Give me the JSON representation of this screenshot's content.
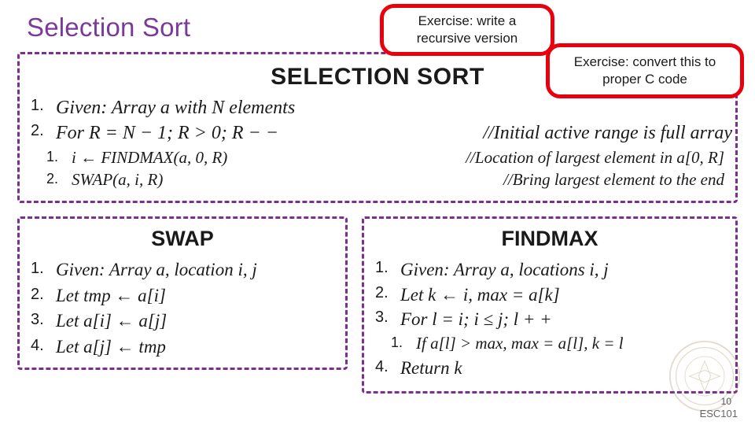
{
  "slide": {
    "title": "Selection Sort",
    "number": "10",
    "course": "ESC101"
  },
  "selection_sort_box": {
    "heading": "SELECTION SORT",
    "steps": [
      {
        "num": "1.",
        "code": "Given: Array a with N elements",
        "comment": ""
      },
      {
        "num": "2.",
        "code": "For R = N − 1; R > 0; R − −",
        "comment": "//Initial active range is full array"
      }
    ],
    "substeps": [
      {
        "num": "1.",
        "code": "i ← FINDMAX(a, 0, R)",
        "comment": "//Location of largest element in a[0, R]"
      },
      {
        "num": "2.",
        "code": "SWAP(a, i, R)",
        "comment": "//Bring largest element to the end"
      }
    ]
  },
  "swap_box": {
    "heading": "SWAP",
    "steps": [
      {
        "num": "1.",
        "code": "Given: Array a, location i, j"
      },
      {
        "num": "2.",
        "code": "Let tmp ← a[i]"
      },
      {
        "num": "3.",
        "code": "Let a[i] ← a[j]"
      },
      {
        "num": "4.",
        "code": "Let a[j] ← tmp"
      }
    ]
  },
  "findmax_box": {
    "heading": "FINDMAX",
    "steps": [
      {
        "num": "1.",
        "code": "Given: Array a, locations i, j"
      },
      {
        "num": "2.",
        "code": "Let k ← i, max = a[k]"
      },
      {
        "num": "3.",
        "code": "For l = i; i ≤ j; l + +"
      },
      {
        "num": "4.",
        "code": "Return k"
      }
    ],
    "substeps": [
      {
        "num": "1.",
        "code": "If a[l] > max, max = a[l], k = l"
      }
    ]
  },
  "callouts": {
    "recursive": "Exercise: write a recursive version",
    "c_code": "Exercise: convert this to proper C code"
  },
  "colors": {
    "title_purple": "#7a3a9c",
    "dashed_purple": "#7b2f8f",
    "callout_red": "#e8000d"
  }
}
